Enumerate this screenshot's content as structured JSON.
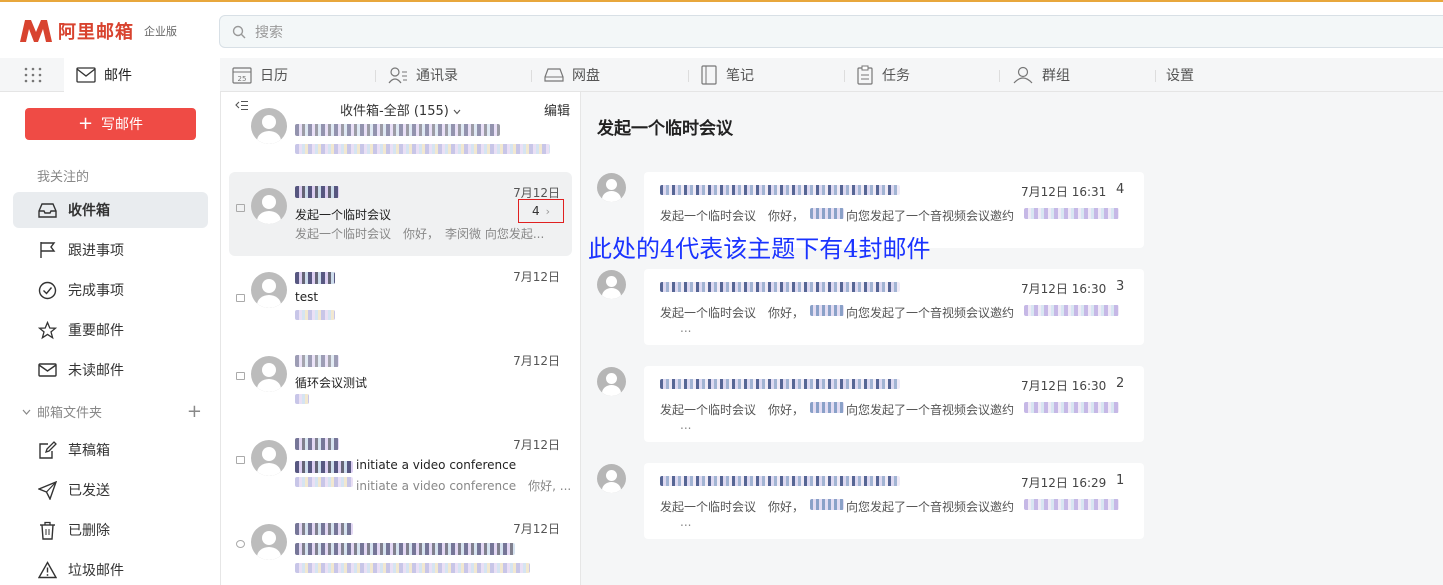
{
  "brand": {
    "name": "阿里邮箱",
    "edition": "企业版"
  },
  "search": {
    "placeholder": "搜索"
  },
  "nav": {
    "mail": "邮件",
    "calendar": "日历",
    "calendar_day": "25",
    "contacts": "通讯录",
    "drive": "网盘",
    "notes": "笔记",
    "tasks": "任务",
    "groups": "群组",
    "settings": "设置"
  },
  "sidebar": {
    "compose": "写邮件",
    "followed_title": "我关注的",
    "items": [
      {
        "label": "收件箱",
        "icon": "inbox-icon"
      },
      {
        "label": "跟进事项",
        "icon": "flag-icon"
      },
      {
        "label": "完成事项",
        "icon": "check-circle-icon"
      },
      {
        "label": "重要邮件",
        "icon": "star-icon"
      },
      {
        "label": "未读邮件",
        "icon": "envelope-icon"
      }
    ],
    "folders_title": "邮箱文件夹",
    "folders": [
      {
        "label": "草稿箱",
        "icon": "draft-icon"
      },
      {
        "label": "已发送",
        "icon": "send-icon"
      },
      {
        "label": "已删除",
        "icon": "trash-icon"
      },
      {
        "label": "垃圾邮件",
        "icon": "warning-icon"
      }
    ]
  },
  "list": {
    "title": "收件箱-全部 (155)",
    "edit": "编辑",
    "rows": [
      {
        "date": "7月12日",
        "subject": "发起一个临时会议",
        "preview": "发起一个临时会议　你好，　李闵微 向您发起...",
        "count": "4"
      },
      {
        "date": "7月12日",
        "subject": "test",
        "preview": ""
      },
      {
        "date": "7月12日",
        "subject": "循环会议测试",
        "preview": ""
      },
      {
        "date": "7月12日",
        "subject": "initiate a video conference",
        "preview": "initiate a video conference　你好, ..."
      },
      {
        "date": "7月12日",
        "subject": "",
        "preview": ""
      }
    ]
  },
  "reader": {
    "title": "发起一个临时会议",
    "annotation": "此处的4代表该主题下有4封邮件",
    "messages": [
      {
        "time": "7月12日 16:31",
        "num": "4",
        "text": "发起一个临时会议　你好，　　　　向您发起了一个音视频会议邀约",
        "more": ""
      },
      {
        "time": "7月12日 16:30",
        "num": "3",
        "text": "发起一个临时会议　你好，　　　　向您发起了一个音视频会议邀约",
        "more": "..."
      },
      {
        "time": "7月12日 16:30",
        "num": "2",
        "text": "发起一个临时会议　你好，　　　　向您发起了一个音视频会议邀约",
        "more": "..."
      },
      {
        "time": "7月12日 16:29",
        "num": "1",
        "text": "发起一个临时会议　你好，　　　　向您发起了一个音视频会议邀约",
        "more": "..."
      }
    ]
  },
  "colors": {
    "accent": "#ef4b45",
    "brand": "#d8432f",
    "annotation": "#1a33ff",
    "highlight_box": "#e02020"
  }
}
